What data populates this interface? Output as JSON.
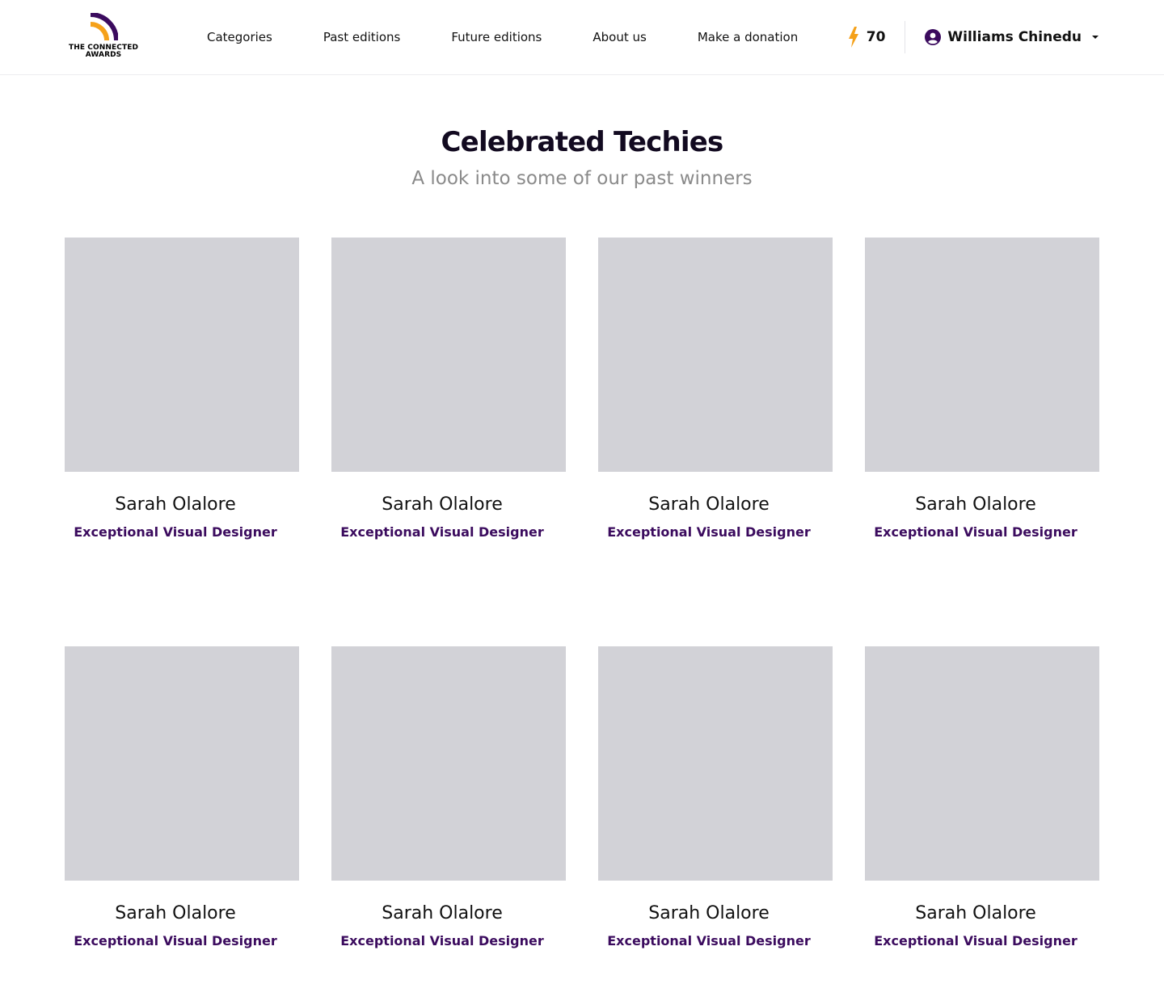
{
  "brand": {
    "line1": "THE CONNECTED",
    "line2": "AWARDS",
    "purple": "#3b0b5e",
    "orange": "#f5a11a"
  },
  "nav": {
    "items": [
      {
        "label": "Categories"
      },
      {
        "label": "Past editions"
      },
      {
        "label": "Future editions"
      },
      {
        "label": "About us"
      },
      {
        "label": "Make a donation"
      }
    ]
  },
  "header": {
    "points": "70",
    "points_icon": "lightning-bolt-icon",
    "user_name": "Williams Chinedu",
    "user_icon": "user-circle-icon",
    "dropdown_icon": "caret-down-icon"
  },
  "hero": {
    "title": "Celebrated Techies",
    "subtitle": "A look into some of our past winners"
  },
  "winners": [
    {
      "name": "Sarah Olalore",
      "role": "Exceptional Visual Designer"
    },
    {
      "name": "Sarah Olalore",
      "role": "Exceptional Visual Designer"
    },
    {
      "name": "Sarah Olalore",
      "role": "Exceptional Visual Designer"
    },
    {
      "name": "Sarah Olalore",
      "role": "Exceptional Visual Designer"
    },
    {
      "name": "Sarah Olalore",
      "role": "Exceptional Visual Designer"
    },
    {
      "name": "Sarah Olalore",
      "role": "Exceptional Visual Designer"
    },
    {
      "name": "Sarah Olalore",
      "role": "Exceptional Visual Designer"
    },
    {
      "name": "Sarah Olalore",
      "role": "Exceptional Visual Designer"
    }
  ]
}
